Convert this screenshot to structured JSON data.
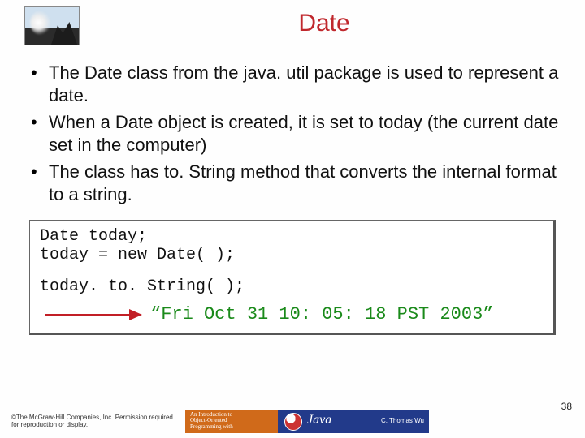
{
  "title": "Date",
  "bullets": [
    "The Date class from the java. util package is used to represent a date.",
    "When a Date object is created, it is set to today (the current date set in the computer)",
    "The class has to. String method that converts the internal format to a string."
  ],
  "code": {
    "line1": "Date today;",
    "line2": "today = new Date( );",
    "line3": "today. to. String( );",
    "result": "“Fri Oct 31 10: 05: 18 PST 2003”"
  },
  "footer": {
    "copyright": "©The McGraw-Hill Companies, Inc. Permission required for reproduction or display.",
    "book_intro_l1": "An Introduction to",
    "book_intro_l2": "Object-Oriented",
    "book_intro_l3": "Programming with",
    "book_lang": "Java",
    "book_author": "C. Thomas Wu"
  },
  "page_number": "38"
}
